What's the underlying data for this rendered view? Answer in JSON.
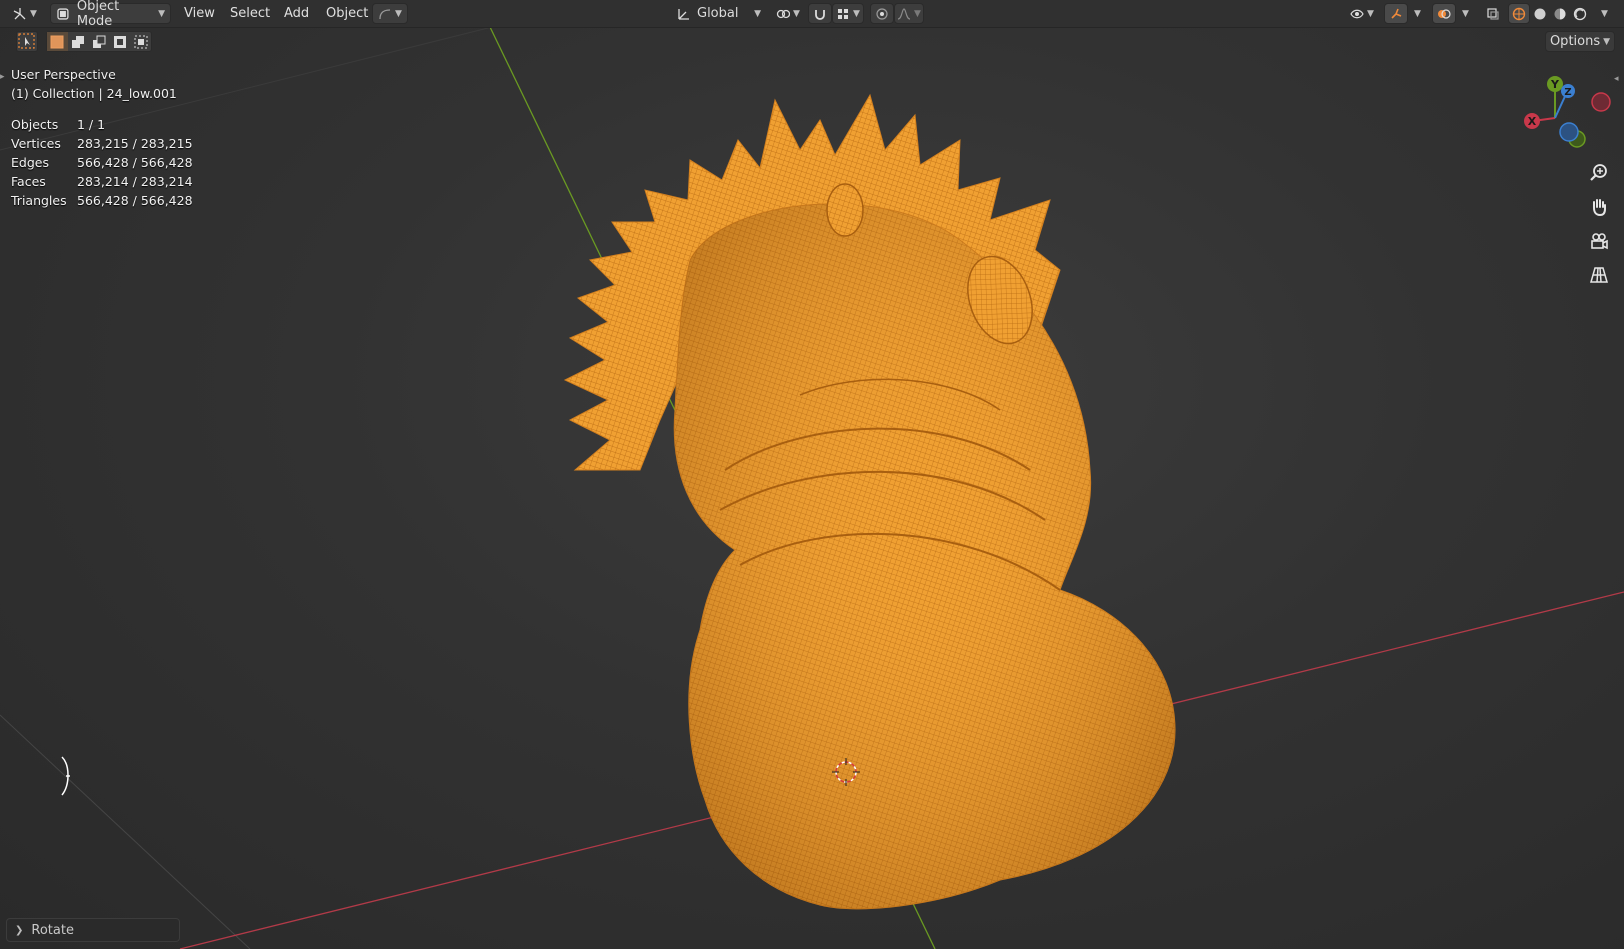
{
  "header": {
    "mode_label": "Object Mode",
    "menus": [
      "View",
      "Select",
      "Add",
      "Object"
    ],
    "transform_orientation": "Global",
    "options_label": "Options"
  },
  "overlay": {
    "view_name": "User Perspective",
    "collection_label": "(1) Collection | 24_low.001",
    "stats": [
      {
        "label": "Objects",
        "value": "1 / 1"
      },
      {
        "label": "Vertices",
        "value": "283,215 / 283,215"
      },
      {
        "label": "Edges",
        "value": "566,428 / 566,428"
      },
      {
        "label": "Faces",
        "value": "283,214 / 283,214"
      },
      {
        "label": "Triangles",
        "value": "566,428 / 566,428"
      }
    ]
  },
  "gizmo": {
    "x_label": "X",
    "y_label": "Y",
    "z_label": "Z"
  },
  "last_operator": {
    "label": "Rotate"
  },
  "colors": {
    "mesh_orange": "#f29a2e",
    "x_axis_red": "#c8384a",
    "y_axis_green": "#6a9a22",
    "z_axis_blue": "#3b7fd0",
    "header_bg": "#303030"
  }
}
